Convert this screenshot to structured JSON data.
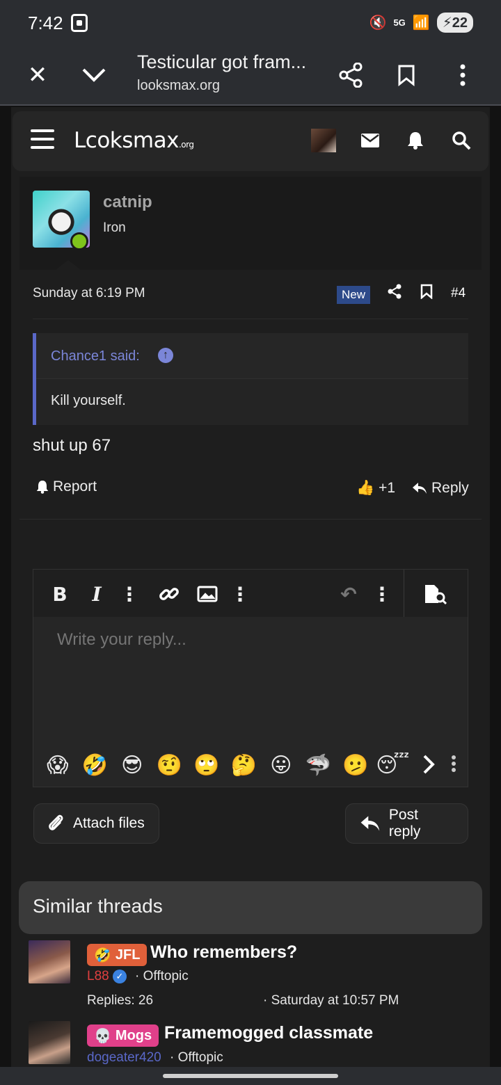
{
  "status_bar": {
    "time": "7:42",
    "network": "5G",
    "battery": "22"
  },
  "tab_bar": {
    "title": "Testicular got fram...",
    "url": "looksmax.org"
  },
  "site_header": {
    "logo_main": "Lcoksmax",
    "logo_suffix": ".org"
  },
  "post": {
    "username": "catnip",
    "rank": "Iron",
    "date": "Sunday at 6:19 PM",
    "badge": "New",
    "number": "#4",
    "quote_author": "Chance1 said:",
    "quote_text": "Kill yourself.",
    "body": "shut up 67",
    "report_label": "Report",
    "like_count": "+1",
    "reply_label": "Reply"
  },
  "editor": {
    "placeholder": "Write your reply...",
    "emojis": [
      "😱",
      "🤣",
      "😎",
      "🤨",
      "🙄",
      "🤔",
      "😛",
      "🦈",
      "🫤",
      "😴"
    ]
  },
  "buttons": {
    "attach_files": "Attach files",
    "post_reply": "Post reply"
  },
  "similar_threads": {
    "heading": "Similar threads",
    "threads": [
      {
        "tag": "JFL",
        "tag_color": "#e0603a",
        "title": "Who remembers?",
        "author": "L88",
        "author_color": "#e04040",
        "forum": "Offtopic",
        "replies": "Replies: 26",
        "date": "Saturday at 10:57 PM"
      },
      {
        "tag": "Mogs",
        "tag_color": "#e0408a",
        "title": "Framemogged classmate",
        "author": "dogeater420",
        "author_color": "#5a68c8",
        "forum": "Offtopic"
      }
    ]
  }
}
